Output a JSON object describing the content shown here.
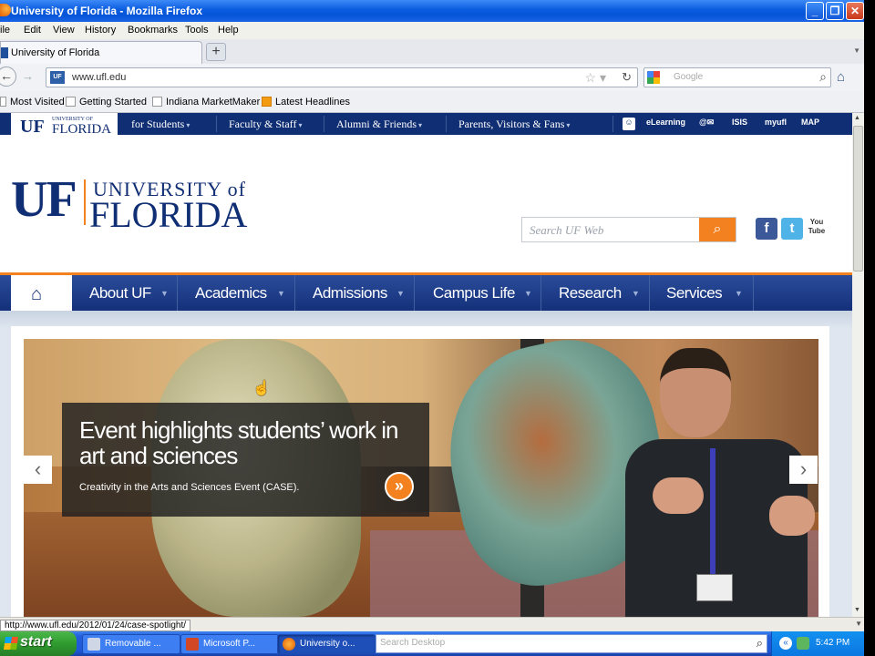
{
  "window": {
    "title": "University of Florida - Mozilla Firefox",
    "min": "_",
    "max": "❐",
    "close": "✕"
  },
  "menu": [
    "File",
    "Edit",
    "View",
    "History",
    "Bookmarks",
    "Tools",
    "Help"
  ],
  "menu_visible": [
    "ile",
    "Edit",
    "View",
    "History",
    "Bookmarks",
    "Tools",
    "Help"
  ],
  "tab": {
    "label": "University of Florida",
    "newtab": "+"
  },
  "nav": {
    "url": "www.ufl.edu",
    "site_badge": "UF",
    "search_placeholder": "Google"
  },
  "bookmarks": [
    "Most Visited",
    "Getting Started",
    "Indiana MarketMaker",
    "Latest Headlines"
  ],
  "uf_top": {
    "logo_uf": "UF",
    "logo_university": "UNIVERSITY OF",
    "logo_florida": "FLORIDA",
    "links": [
      "for Students",
      "Faculty & Staff",
      "Alumni & Friends",
      "Parents, Visitors & Fans"
    ],
    "quick": [
      "eLearning",
      "@✉",
      "ISIS",
      "myufl",
      "MAP"
    ]
  },
  "header": {
    "uf": "UF",
    "university_of": "UNIVERSITY of",
    "florida": "FLORIDA",
    "search_placeholder": "Search UF Web",
    "social": [
      "f",
      "t",
      "You Tube"
    ]
  },
  "main_nav": [
    "About UF",
    "Academics",
    "Admissions",
    "Campus Life",
    "Research",
    "Services"
  ],
  "hero": {
    "headline": "Event highlights students’ work in art and sciences",
    "subtext": "Creativity in the Arts and Sciences Event (CASE).",
    "prev": "‹",
    "next": "›",
    "more": "»"
  },
  "status": {
    "url": "http://www.ufl.edu/2012/01/24/case-spotlight/"
  },
  "taskbar": {
    "start": "start",
    "tasks": [
      "Removable ...",
      "Microsoft P...",
      "University o..."
    ],
    "search_placeholder": "Search Desktop",
    "clock": "5:42 PM"
  },
  "colors": {
    "uf_blue": "#0f2e73",
    "uf_orange": "#f4811f"
  }
}
